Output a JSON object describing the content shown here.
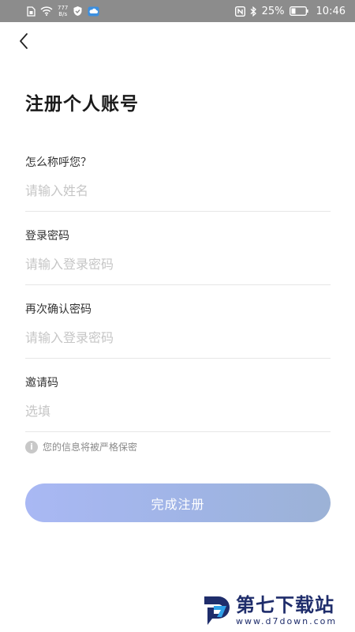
{
  "status_bar": {
    "net_speed_top": "777",
    "net_speed_bottom": "B/s",
    "battery": "25%",
    "time": "10:46"
  },
  "title": "注册个人账号",
  "fields": [
    {
      "label": "怎么称呼您？",
      "placeholder": "请输入姓名",
      "value": ""
    },
    {
      "label": "登录密码",
      "placeholder": "请输入登录密码",
      "value": ""
    },
    {
      "label": "再次确认密码",
      "placeholder": "请输入登录密码",
      "value": ""
    },
    {
      "label": "邀请码",
      "placeholder": "选填",
      "value": ""
    }
  ],
  "privacy_note": "您的信息将被严格保密",
  "submit_label": "完成注册",
  "watermark": {
    "name": "第七下载站",
    "url": "www.d7down.com"
  },
  "colors": {
    "status_bar_bg": "#8c8c8c",
    "button_gradient_start": "#a9b8f4",
    "button_gradient_end": "#9cb2d6",
    "watermark_blue": "#1f2d6b"
  }
}
